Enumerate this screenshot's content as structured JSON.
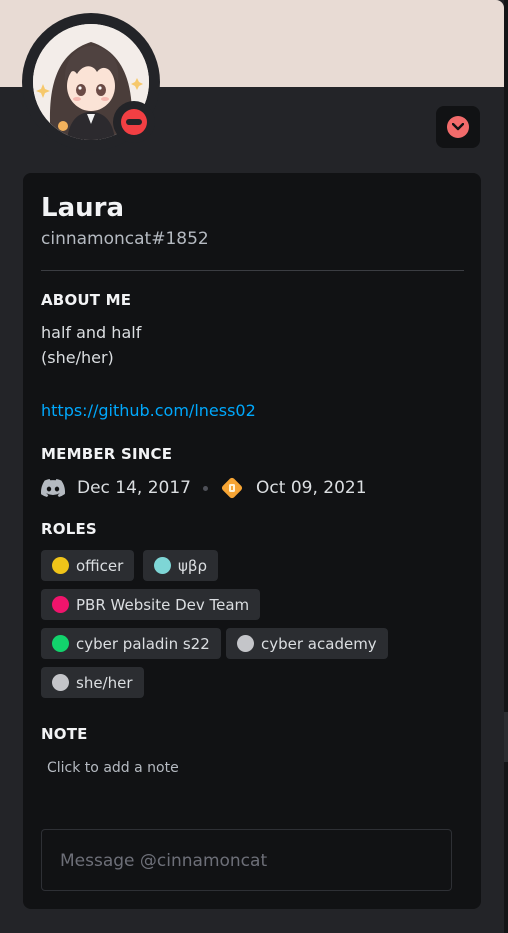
{
  "profile": {
    "display_name": "Laura",
    "username": "cinnamoncat#1852",
    "status": "do-not-disturb",
    "banner_color": "#e8dbd4",
    "badge_icon": "chevron-down-badge-icon"
  },
  "about": {
    "title": "ABOUT ME",
    "lines": [
      "half and half",
      "(she/her)"
    ],
    "link": "https://github.com/lness02"
  },
  "member_since": {
    "title": "MEMBER SINCE",
    "discord_date": "Dec 14, 2017",
    "server_date": "Oct 09, 2021",
    "discord_icon": "discord-logo-icon",
    "server_icon": "server-icon"
  },
  "roles": {
    "title": "ROLES",
    "items": [
      {
        "label": "officer",
        "color": "#f0c419"
      },
      {
        "label": "ψβρ",
        "color": "#7ed6d6"
      },
      {
        "label": "PBR Website Dev Team",
        "color": "#f0146c"
      },
      {
        "label": "cyber paladin s22",
        "color": "#12d36c"
      },
      {
        "label": "cyber academy",
        "color": "#c4c5c9"
      },
      {
        "label": "she/her",
        "color": "#c4c5c9"
      }
    ]
  },
  "note": {
    "title": "NOTE",
    "placeholder": "Click to add a note"
  },
  "message": {
    "placeholder": "Message @cinnamoncat"
  }
}
